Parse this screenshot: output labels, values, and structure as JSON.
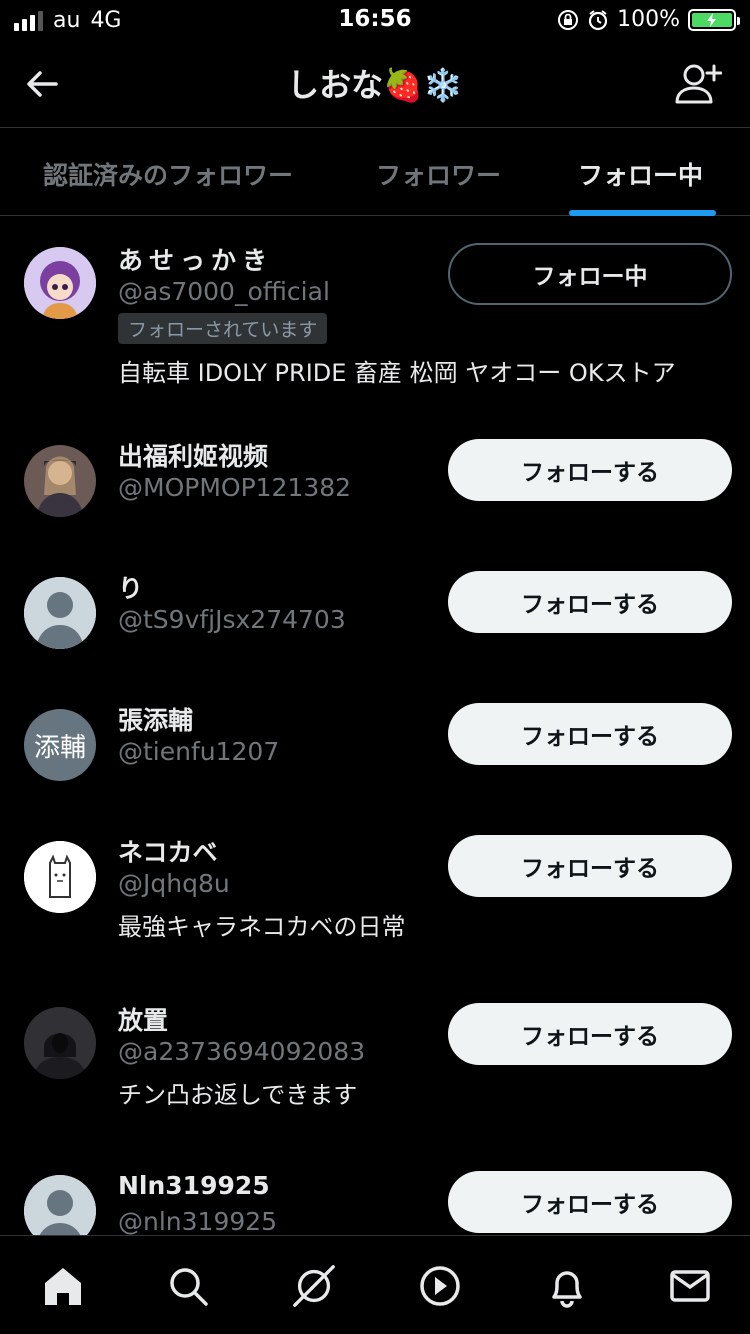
{
  "status_bar": {
    "carrier": "au",
    "network": "4G",
    "time": "16:56",
    "battery": "100%"
  },
  "header": {
    "title": "しおな🍓❄️"
  },
  "tabs": [
    {
      "label": "認証済みのフォロワー",
      "active": false
    },
    {
      "label": "フォロワー",
      "active": false
    },
    {
      "label": "フォロー中",
      "active": true
    }
  ],
  "users": [
    {
      "name": "あせっかき",
      "handle": "@as7000_official",
      "follows_you": "フォローされています",
      "bio": "自転車 IDOLY PRIDE 畜産 松岡 ヤオコー OKストア",
      "button": "フォロー中"
    },
    {
      "name": "出福利姬视频",
      "handle": "@MOPMOP121382",
      "button": "フォローする"
    },
    {
      "name": "り",
      "handle": "@tS9vfjJsx274703",
      "button": "フォローする"
    },
    {
      "name": "張添輔",
      "handle": "@tienfu1207",
      "avatar_text": "添輔",
      "button": "フォローする"
    },
    {
      "name": "ネコカベ",
      "handle": "@Jqhq8u",
      "bio": "最強キャラネコカベの日常",
      "button": "フォローする"
    },
    {
      "name": "放置",
      "handle": "@a2373694092083",
      "bio": "チン凸お返しできます",
      "button": "フォローする"
    },
    {
      "name": "Nln319925",
      "handle": "@nln319925",
      "button": "フォローする"
    }
  ],
  "colors": {
    "background": "#000000",
    "accent": "#1d9bf0",
    "secondary_text": "#71767b",
    "follow_button": "#eff3f4"
  },
  "nav": [
    "home-icon",
    "search-icon",
    "spaces-icon",
    "video-icon",
    "notifications-icon",
    "messages-icon"
  ]
}
